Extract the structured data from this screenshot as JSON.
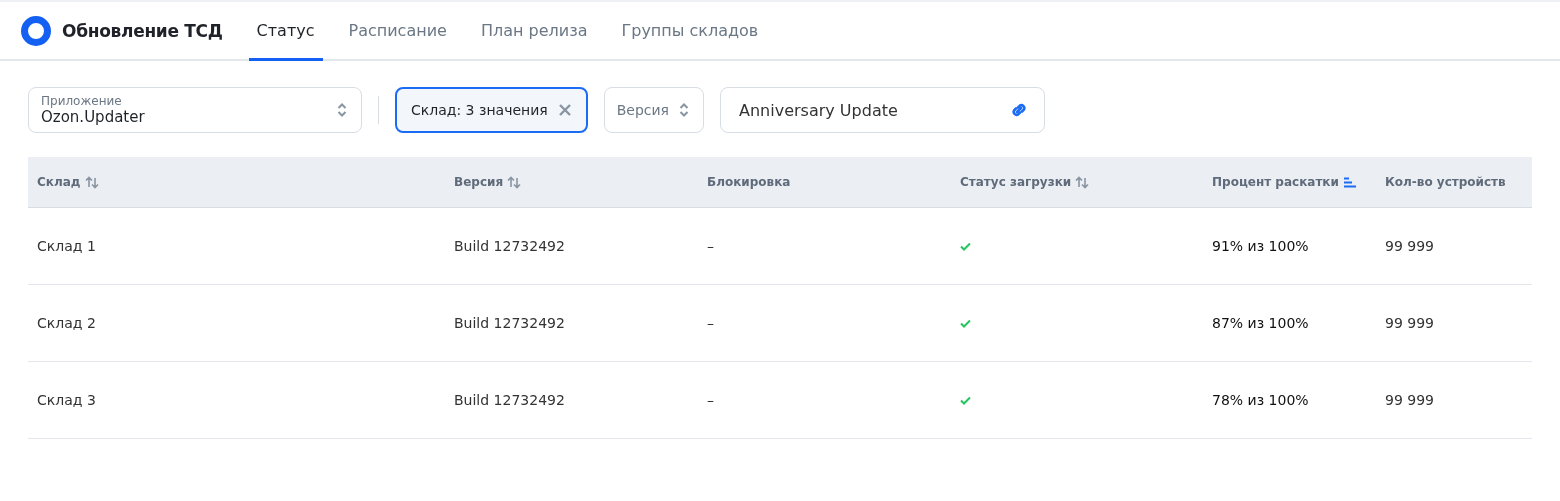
{
  "app": {
    "title": "Обновление ТСД"
  },
  "tabs": [
    {
      "label": "Статус",
      "selected": true
    },
    {
      "label": "Расписание",
      "selected": false
    },
    {
      "label": "План релиза",
      "selected": false
    },
    {
      "label": "Группы складов",
      "selected": false
    }
  ],
  "filters": [
    {
      "kind": "select",
      "label": "Приложение",
      "value": "Ozon.Updater"
    },
    {
      "kind": "chip",
      "value": "Склад: 3 значения"
    },
    {
      "kind": "select",
      "placeholder": "Версия"
    },
    {
      "kind": "link",
      "value": "Anniversary Update"
    }
  ],
  "table": {
    "columns": [
      {
        "label": "Склад",
        "sortable": true,
        "sorted": false
      },
      {
        "label": "Версия",
        "sortable": true,
        "sorted": false
      },
      {
        "label": "Блокировка",
        "sortable": false
      },
      {
        "label": "Статус загрузки",
        "sortable": true,
        "sorted": false
      },
      {
        "label": "Процент раскатки",
        "sortable": true,
        "sorted": true
      },
      {
        "label": "Кол-во устройств",
        "sortable": false
      }
    ],
    "rows": [
      {
        "warehouse": "Склад 1",
        "version": "Build 12732492",
        "block": "–",
        "loaded": true,
        "percent": "91% из 100%",
        "devices": "99 999"
      },
      {
        "warehouse": "Склад 2",
        "version": "Build 12732492",
        "block": "–",
        "loaded": true,
        "percent": "87% из 100%",
        "devices": "99 999"
      },
      {
        "warehouse": "Склад 3",
        "version": "Build 12732492",
        "block": "–",
        "loaded": true,
        "percent": "78% из 100%",
        "devices": "99 999"
      }
    ]
  }
}
